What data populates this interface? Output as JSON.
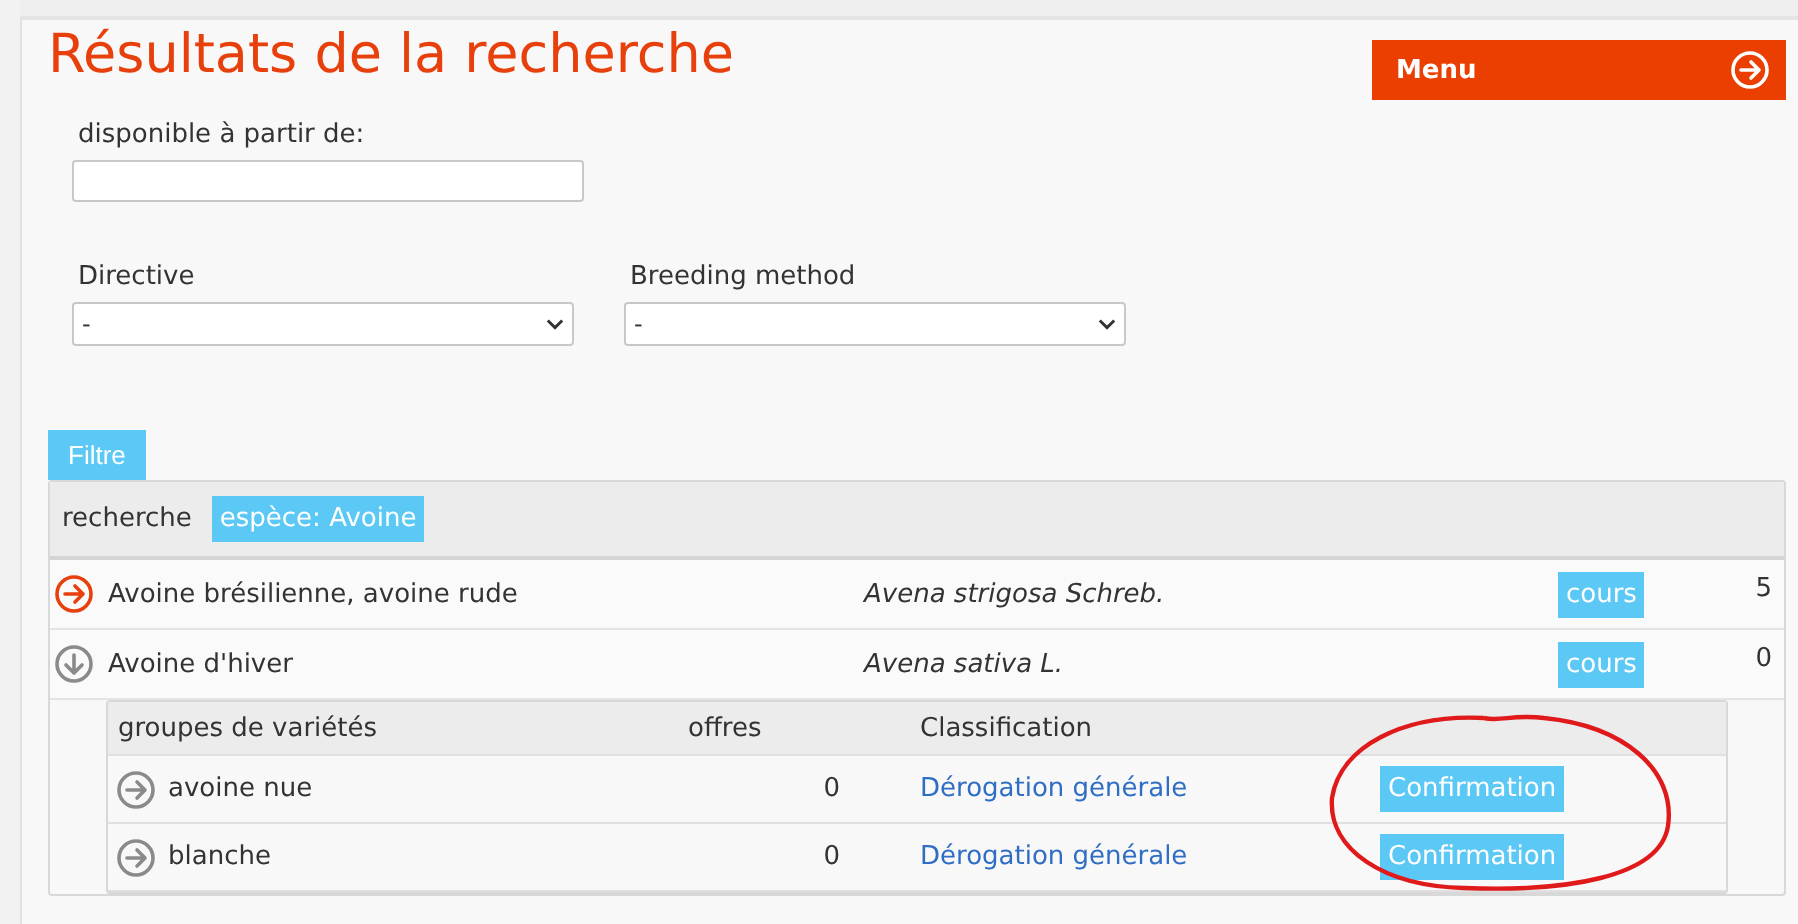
{
  "title": "Résultats de la recherche",
  "menu_button": {
    "label": "Menu"
  },
  "date_field": {
    "label": "disponible à partir de:"
  },
  "selects": [
    {
      "label": "Directive",
      "value": "-"
    },
    {
      "label": "Breeding method",
      "value": "-"
    }
  ],
  "tabs": [
    {
      "label": "Filtre",
      "selected": true
    }
  ],
  "search_bar": {
    "label": "recherche",
    "tag": "espèce: Avoine"
  },
  "species": [
    {
      "name": "Avoine brésilienne, avoine rude",
      "latin": "Avena strigosa Schreb.",
      "tag": "cours",
      "count": "5",
      "expanded": false
    },
    {
      "name": "Avoine d'hiver",
      "latin": "Avena sativa L.",
      "tag": "cours",
      "count": "0",
      "expanded": true,
      "groups": {
        "columns": [
          "groupes de variétés",
          "offres",
          "Classification"
        ],
        "rows": [
          {
            "name": "avoine nue",
            "offers": "0",
            "classification": "Dérogation générale",
            "status": "Confirmation"
          },
          {
            "name": "blanche",
            "offers": "0",
            "classification": "Dérogation générale",
            "status": "Confirmation"
          }
        ]
      }
    }
  ]
}
